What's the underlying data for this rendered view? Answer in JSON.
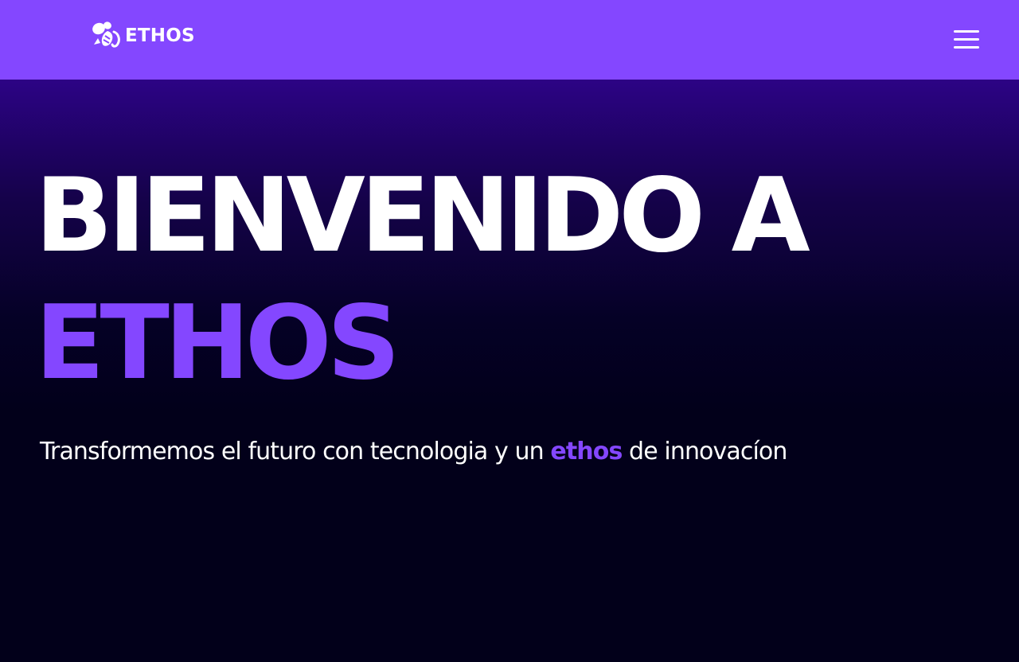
{
  "header": {
    "logo_text": "ETHOS",
    "logo_icon": "bee-logo-icon",
    "menu_icon": "hamburger-menu-icon",
    "background_color": "#8447ff"
  },
  "hero": {
    "title_line_1": "BIENVENIDO A",
    "title_line_2": "ETHOS",
    "subtitle_before": "Transformemos el futuro con tecnologia y un ",
    "subtitle_highlight": "ethos",
    "subtitle_after": " de innovacíon",
    "accent_color": "#8447ff",
    "gradient_top_color": "#2c0385",
    "background_color": "#02001a"
  }
}
